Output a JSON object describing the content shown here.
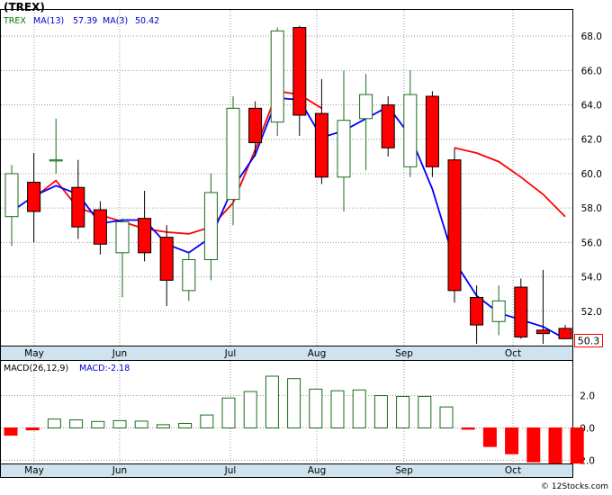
{
  "title": "(TREX)",
  "legend": {
    "ticker": "TREX",
    "ma13_label": "MA(13)",
    "ma13_value": "57.39",
    "ma3_label": "MA(3)",
    "ma3_value": "50.42",
    "macd_label": "MACD(26,12,9)",
    "macd_value_label": "MACD:-2.18"
  },
  "last_price_label": "50.3",
  "watermark": "© 12Stocks.com",
  "colors": {
    "up_outline": "#1a6b1a",
    "down_fill": "#ff0000",
    "ma13": "#ff0000",
    "ma3": "#0000ff",
    "axis_band": "#cfe3ee",
    "grid": "#999999",
    "text": "#000000",
    "legend_ticker": "#007700"
  },
  "chart_data": [
    {
      "type": "candlestick",
      "title": "(TREX)",
      "months": [
        "May",
        "Jun",
        "Jul",
        "Aug",
        "Sep",
        "Oct"
      ],
      "y_ticks": [
        "52.0",
        "54.0",
        "56.0",
        "58.0",
        "60.0",
        "62.0",
        "64.0",
        "66.0",
        "68.0"
      ],
      "ylim": [
        50,
        69
      ],
      "grid": true,
      "candles": [
        {
          "open": 57.5,
          "high": 60.5,
          "low": 55.8,
          "close": 60.0
        },
        {
          "open": 59.5,
          "high": 61.2,
          "low": 56.0,
          "close": 57.8
        },
        {
          "open": 60.8,
          "high": 63.2,
          "low": 60.0,
          "close": 60.8
        },
        {
          "open": 59.2,
          "high": 60.8,
          "low": 56.2,
          "close": 56.9
        },
        {
          "open": 57.9,
          "high": 58.4,
          "low": 55.3,
          "close": 55.9
        },
        {
          "open": 55.4,
          "high": 57.4,
          "low": 52.8,
          "close": 57.2
        },
        {
          "open": 57.4,
          "high": 59.0,
          "low": 54.9,
          "close": 55.4
        },
        {
          "open": 56.3,
          "high": 57.0,
          "low": 52.3,
          "close": 53.8
        },
        {
          "open": 53.2,
          "high": 55.5,
          "low": 52.6,
          "close": 55.0
        },
        {
          "open": 55.0,
          "high": 60.0,
          "low": 53.8,
          "close": 58.9
        },
        {
          "open": 58.5,
          "high": 64.5,
          "low": 57.0,
          "close": 63.8
        },
        {
          "open": 63.8,
          "high": 64.2,
          "low": 61.0,
          "close": 61.8
        },
        {
          "open": 63.0,
          "high": 68.5,
          "low": 62.2,
          "close": 68.3
        },
        {
          "open": 68.5,
          "high": 68.6,
          "low": 62.2,
          "close": 63.4
        },
        {
          "open": 63.5,
          "high": 65.5,
          "low": 59.4,
          "close": 59.8
        },
        {
          "open": 59.8,
          "high": 66.0,
          "low": 57.8,
          "close": 63.1
        },
        {
          "open": 63.2,
          "high": 65.8,
          "low": 60.2,
          "close": 64.6
        },
        {
          "open": 64.0,
          "high": 64.5,
          "low": 61.0,
          "close": 61.5
        },
        {
          "open": 60.4,
          "high": 66.0,
          "low": 59.8,
          "close": 64.6
        },
        {
          "open": 64.5,
          "high": 64.8,
          "low": 59.8,
          "close": 60.4
        },
        {
          "open": 60.8,
          "high": 61.5,
          "low": 52.5,
          "close": 53.2
        },
        {
          "open": 52.8,
          "high": 53.5,
          "low": 50.1,
          "close": 51.2
        },
        {
          "open": 51.4,
          "high": 53.5,
          "low": 50.6,
          "close": 52.6
        },
        {
          "open": 53.4,
          "high": 53.9,
          "low": 50.4,
          "close": 50.5
        },
        {
          "open": 50.9,
          "high": 54.4,
          "low": 50.1,
          "close": 50.7
        },
        {
          "open": 51.0,
          "high": 51.2,
          "low": 50.4,
          "close": 50.4
        }
      ],
      "ma13": [
        null,
        58.6,
        59.6,
        58.0,
        57.6,
        57.2,
        56.8,
        56.6,
        56.5,
        56.9,
        58.3,
        61.4,
        64.8,
        64.6,
        63.8,
        null,
        null,
        null,
        null,
        null,
        61.5,
        61.2,
        60.7,
        59.8,
        58.8,
        57.5
      ],
      "ma3": [
        57.8,
        58.7,
        59.3,
        58.8,
        57.1,
        57.3,
        57.3,
        55.9,
        55.4,
        56.3,
        59.2,
        61.1,
        64.4,
        64.3,
        62.1,
        62.5,
        63.2,
        63.9,
        62.2,
        59.1,
        54.9,
        52.9,
        51.9,
        51.5,
        51.1,
        50.4
      ]
    },
    {
      "type": "bar",
      "title": "MACD(26,12,9)",
      "months": [
        "May",
        "Jun",
        "Jul",
        "Aug",
        "Sep",
        "Oct"
      ],
      "y_ticks": [
        "-2.0",
        "0.0",
        "2.0"
      ],
      "ylim": [
        -2.2,
        3.2
      ],
      "values": [
        -0.45,
        -0.12,
        0.55,
        0.5,
        0.4,
        0.45,
        0.42,
        0.2,
        0.28,
        0.8,
        1.85,
        2.25,
        3.2,
        3.05,
        2.4,
        2.3,
        2.35,
        2.0,
        1.95,
        1.95,
        1.3,
        -0.08,
        -1.15,
        -1.6,
        -2.1,
        -2.2,
        -2.18
      ]
    }
  ]
}
